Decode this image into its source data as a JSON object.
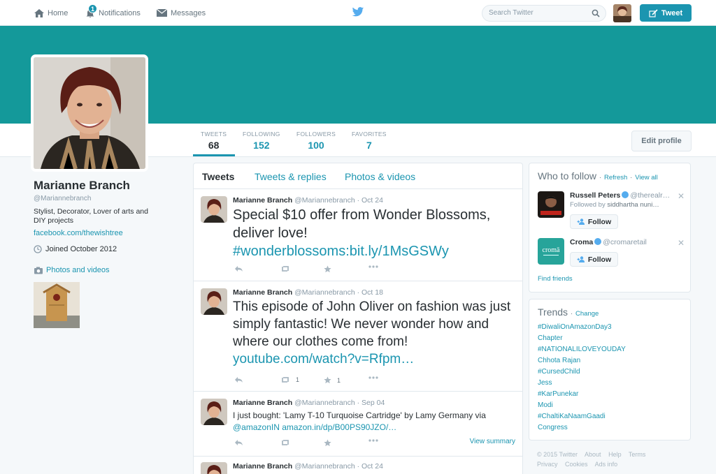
{
  "nav": {
    "home": "Home",
    "notifications": "Notifications",
    "notif_count": "1",
    "messages": "Messages",
    "search_placeholder": "Search Twitter",
    "tweet_button": "Tweet"
  },
  "stats": [
    {
      "label": "TWEETS",
      "value": "68"
    },
    {
      "label": "FOLLOWING",
      "value": "152"
    },
    {
      "label": "FOLLOWERS",
      "value": "100"
    },
    {
      "label": "FAVORITES",
      "value": "7"
    }
  ],
  "edit_profile": "Edit profile",
  "profile": {
    "name": "Marianne Branch",
    "handle": "@Mariannebranch",
    "bio": "Stylist, Decorator, Lover of arts and DIY projects",
    "link": "facebook.com/thewishtree",
    "joined": "Joined October 2012",
    "photos_label": "Photos and videos"
  },
  "tabs": [
    "Tweets",
    "Tweets & replies",
    "Photos & videos"
  ],
  "tweets": [
    {
      "name": "Marianne Branch",
      "handle": "@Mariannebranch",
      "date": "Oct 24",
      "text": "Special $10 offer from Wonder Blossoms, deliver love!",
      "hashtag": "#wonderblossoms",
      "sep": ":",
      "link": "bit.ly/1MsGSWy",
      "retweets": "",
      "favorites": ""
    },
    {
      "name": "Marianne Branch",
      "handle": "@Mariannebranch",
      "date": "Oct 18",
      "text": "This episode of John Oliver on fashion was just simply fantastic! We never wonder how and where our clothes come from!",
      "link": "youtube.com/watch?v=Rfpm…",
      "retweets": "1",
      "favorites": "1"
    },
    {
      "name": "Marianne Branch",
      "handle": "@Mariannebranch",
      "date": "Sep 04",
      "text": "I just bought: 'Lamy T-10 Turquoise Cartridge' by Lamy Germany via",
      "mention": "@amazonIN",
      "link": "amazon.in/dp/B00PS90JZO/…",
      "view_summary": "View summary"
    },
    {
      "name": "Marianne Branch",
      "handle": "@Mariannebranch",
      "date": "Oct 24"
    }
  ],
  "who_to_follow": {
    "title": "Who to follow",
    "refresh": "Refresh",
    "view_all": "View all",
    "dot": "·",
    "users": [
      {
        "name": "Russell Peters",
        "handle": "@therealr…",
        "followed_by_label": "Followed by",
        "followed_by": "siddhartha nuni…",
        "follow": "Follow"
      },
      {
        "name": "Croma",
        "handle": "@cromaretail",
        "follow": "Follow",
        "logo_text": "cromā"
      }
    ],
    "find_friends": "Find friends"
  },
  "trends": {
    "title": "Trends",
    "change": "Change",
    "items": [
      "#DiwaliOnAmazonDay3",
      "Chapter",
      "#NATIONALILOVEYOUDAY",
      "Chhota Rajan",
      "#CursedChild",
      "Jess",
      "#KarPunekar",
      "Modi",
      "#ChaltiKaNaamGaadi",
      "Congress"
    ]
  },
  "footer": {
    "row1": [
      "© 2015 Twitter",
      "About",
      "Help",
      "Terms"
    ],
    "row2": [
      "Privacy",
      "Cookies",
      "Ads info"
    ]
  },
  "colors": {
    "accent": "#1b95b0",
    "banner": "#14999a",
    "text": "#292f33",
    "muted": "#8899a6"
  }
}
